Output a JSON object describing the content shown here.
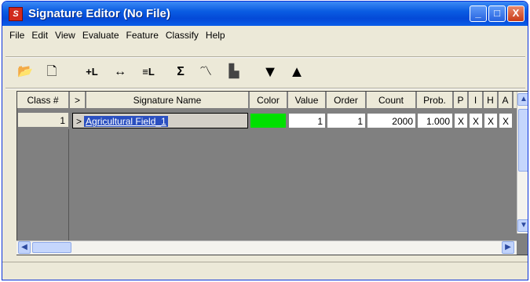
{
  "window": {
    "title": "Signature Editor (No File)",
    "app_icon": "signature-app-icon",
    "buttons": {
      "minimize": "_",
      "maximize": "□",
      "close": "X"
    }
  },
  "menu": [
    "File",
    "Edit",
    "View",
    "Evaluate",
    "Feature",
    "Classify",
    "Help"
  ],
  "toolbar": [
    {
      "name": "open-folder-icon",
      "glyph": "📂"
    },
    {
      "name": "new-document-icon",
      "glyph": "🗋"
    },
    {
      "name": "add-signature-icon",
      "glyph": "+L"
    },
    {
      "name": "replace-signature-icon",
      "glyph": "↔"
    },
    {
      "name": "merge-signatures-icon",
      "glyph": "≡L"
    },
    {
      "name": "statistics-sigma-icon",
      "glyph": "Σ"
    },
    {
      "name": "mean-plot-icon",
      "glyph": "〽"
    },
    {
      "name": "histogram-icon",
      "glyph": "▙"
    },
    {
      "name": "move-down-icon",
      "glyph": "▼"
    },
    {
      "name": "move-up-icon",
      "glyph": "▲"
    }
  ],
  "table": {
    "columns": [
      "Class #",
      ">",
      "Signature Name",
      "Color",
      "Value",
      "Order",
      "Count",
      "Prob.",
      "P",
      "I",
      "H",
      "A"
    ],
    "rows": [
      {
        "class_num": "1",
        "marker": ">",
        "signature_name": "Agricultural Field_1",
        "color": "#00e000",
        "value": "1",
        "order": "1",
        "count": "2000",
        "prob": "1.000",
        "p": "X",
        "i": "X",
        "h": "X",
        "a": "X"
      }
    ]
  },
  "scroll": {
    "up": "▲",
    "down": "▼",
    "left": "◀",
    "right": "▶"
  }
}
